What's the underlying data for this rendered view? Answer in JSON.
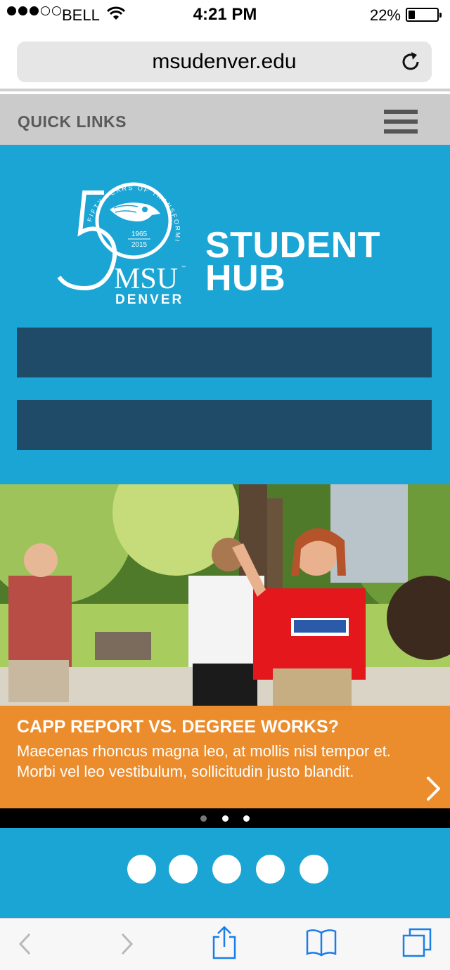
{
  "status_bar": {
    "carrier": "BELL",
    "time": "4:21 PM",
    "battery_percent": "22%",
    "battery_level": 0.22,
    "signal_bars": 3,
    "signal_total": 5
  },
  "browser": {
    "url": "msudenver.edu",
    "reload_icon": "reload-icon"
  },
  "quick_links": {
    "label": "QUICK LINKS",
    "menu_icon": "hamburger-icon"
  },
  "hero": {
    "logo": {
      "arc_text": "FIFTY YEARS OF TRANSFORMING LIVES",
      "numeral": "50",
      "year_start": "1965",
      "year_end": "2015",
      "brand": "MSU",
      "trademark": "™",
      "sub_brand": "DENVER"
    },
    "title_line1": "STUDENT",
    "title_line2": "HUB"
  },
  "slider": {
    "headline": "CAPP REPORT VS. DEGREE WORKS?",
    "body": "Maecenas rhoncus magna leo, at mollis nisl tempor et. Morbi vel leo vestibulum, sollicitudin justo blandit.",
    "next_icon": "chevron-right-icon",
    "page_count": 3,
    "active_page": 2
  },
  "colors": {
    "brand_blue": "#1ba5d5",
    "dark_bar": "#1f4b68",
    "caption_orange": "#ec8723",
    "quicklinks_bg": "#cbcbcb",
    "ios_blue": "#1a7ee8"
  },
  "toolbar": {
    "icons": [
      "back-icon",
      "forward-icon",
      "share-icon",
      "bookmarks-icon",
      "tabs-icon"
    ]
  }
}
